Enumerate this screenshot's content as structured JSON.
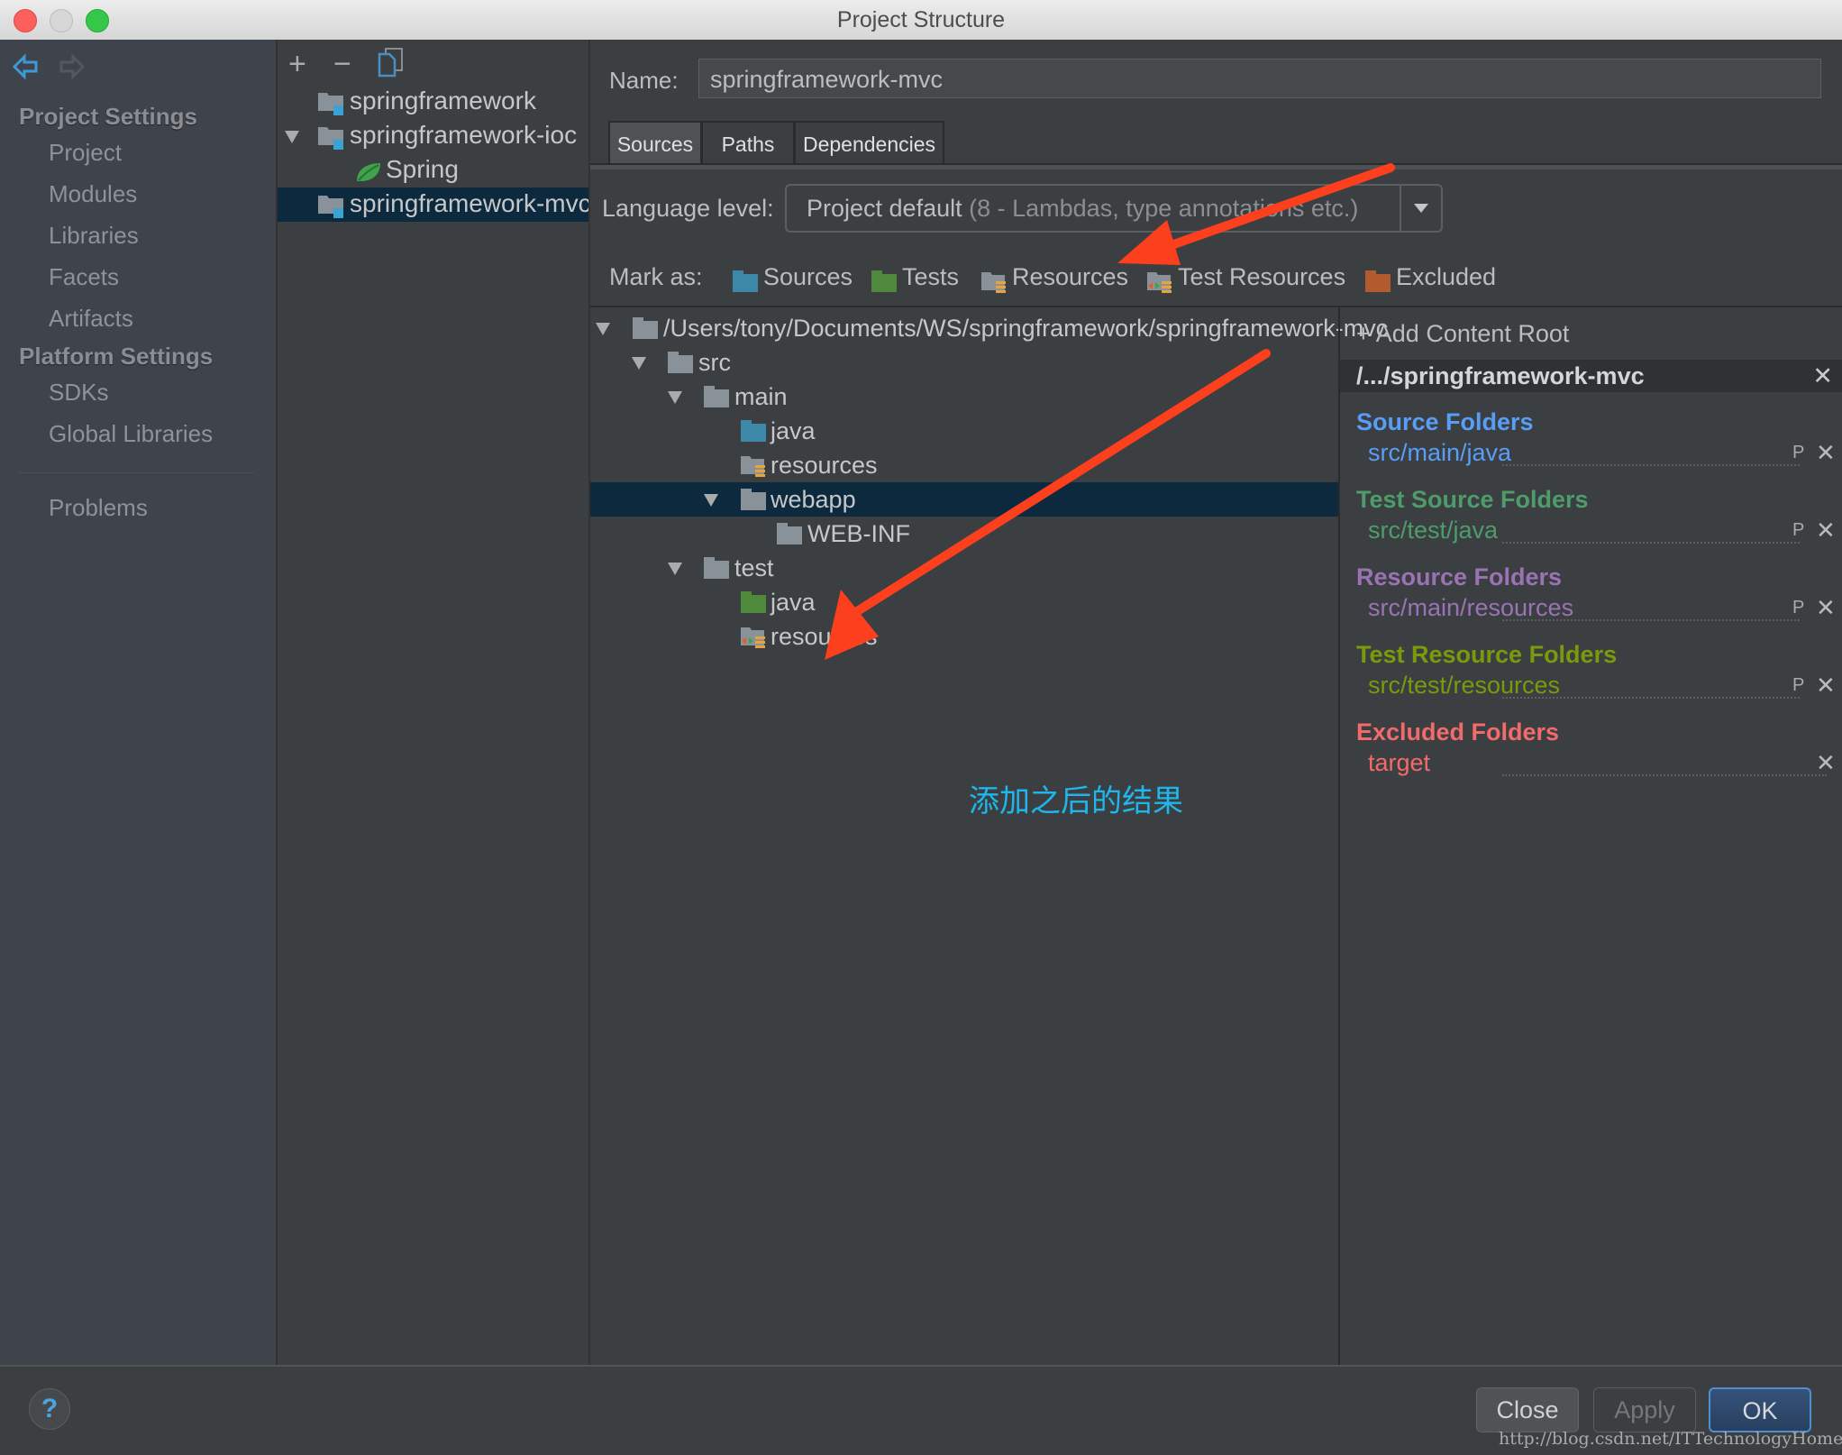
{
  "window": {
    "title": "Project Structure"
  },
  "sidebar": {
    "sections": [
      {
        "title": "Project Settings",
        "items": [
          "Project",
          "Modules",
          "Libraries",
          "Facets",
          "Artifacts"
        ]
      },
      {
        "title": "Platform Settings",
        "items": [
          "SDKs",
          "Global Libraries"
        ]
      }
    ],
    "problems": "Problems"
  },
  "modules": {
    "toolbar": {
      "add": "+",
      "remove": "−"
    },
    "items": [
      {
        "label": "springframework",
        "type": "module",
        "expanded": false,
        "selected": false
      },
      {
        "label": "springframework-ioc",
        "type": "module",
        "expanded": true,
        "selected": false
      },
      {
        "label": "Spring",
        "type": "facet",
        "selected": false
      },
      {
        "label": "springframework-mvc",
        "type": "module",
        "selected": true
      }
    ]
  },
  "main": {
    "name_label": "Name:",
    "name_value": "springframework-mvc",
    "tabs": [
      {
        "label": "Sources",
        "active": true
      },
      {
        "label": "Paths",
        "active": false
      },
      {
        "label": "Dependencies",
        "active": false
      }
    ],
    "language_level_label": "Language level:",
    "language_level_value": "Project default",
    "language_level_detail": "(8 - Lambdas, type annotations etc.)",
    "mark_as_label": "Mark as:",
    "mark_as": [
      {
        "label": "Sources",
        "color": "#3d87a8"
      },
      {
        "label": "Tests",
        "color": "#4f8a3c"
      },
      {
        "label": "Resources",
        "color": "#8a9299"
      },
      {
        "label": "Test Resources",
        "color": "#8a9299"
      },
      {
        "label": "Excluded",
        "color": "#b35b2e"
      }
    ],
    "tree": [
      {
        "label": "/Users/tony/Documents/WS/springframework/springframework-mvc",
        "kind": "plain",
        "expanded": true
      },
      {
        "label": "src",
        "kind": "plain",
        "expanded": true
      },
      {
        "label": "main",
        "kind": "plain",
        "expanded": true
      },
      {
        "label": "java",
        "kind": "source"
      },
      {
        "label": "resources",
        "kind": "resource"
      },
      {
        "label": "webapp",
        "kind": "plain",
        "expanded": true,
        "selected": true
      },
      {
        "label": "WEB-INF",
        "kind": "plain"
      },
      {
        "label": "test",
        "kind": "plain",
        "expanded": true
      },
      {
        "label": "java",
        "kind": "test"
      },
      {
        "label": "resources",
        "kind": "test-resource"
      }
    ],
    "annotation": "添加之后的结果",
    "annotation_color": "#1fb6ec",
    "arrow_color": "#fc3f1d"
  },
  "content_roots": {
    "add_label": "+ Add Content Root",
    "root_header": "/.../springframework-mvc",
    "groups": [
      {
        "title": "Source Folders",
        "path": "src/main/java",
        "color": "#589df6",
        "has_props": true
      },
      {
        "title": "Test Source Folders",
        "path": "src/test/java",
        "color": "#4e9b6b",
        "has_props": true
      },
      {
        "title": "Resource Folders",
        "path": "src/main/resources",
        "color": "#9a73b4",
        "has_props": true
      },
      {
        "title": "Test Resource Folders",
        "path": "src/test/resources",
        "color": "#7a9a0b",
        "has_props": true
      },
      {
        "title": "Excluded Folders",
        "path": "target",
        "color": "#f26a6a",
        "has_props": false
      }
    ],
    "props_icon_label": "P",
    "remove_icon_label": "✕"
  },
  "footer": {
    "help": "?",
    "close": "Close",
    "apply": "Apply",
    "ok": "OK",
    "watermark": "http://blog.csdn.net/ITTechnologyHome"
  }
}
